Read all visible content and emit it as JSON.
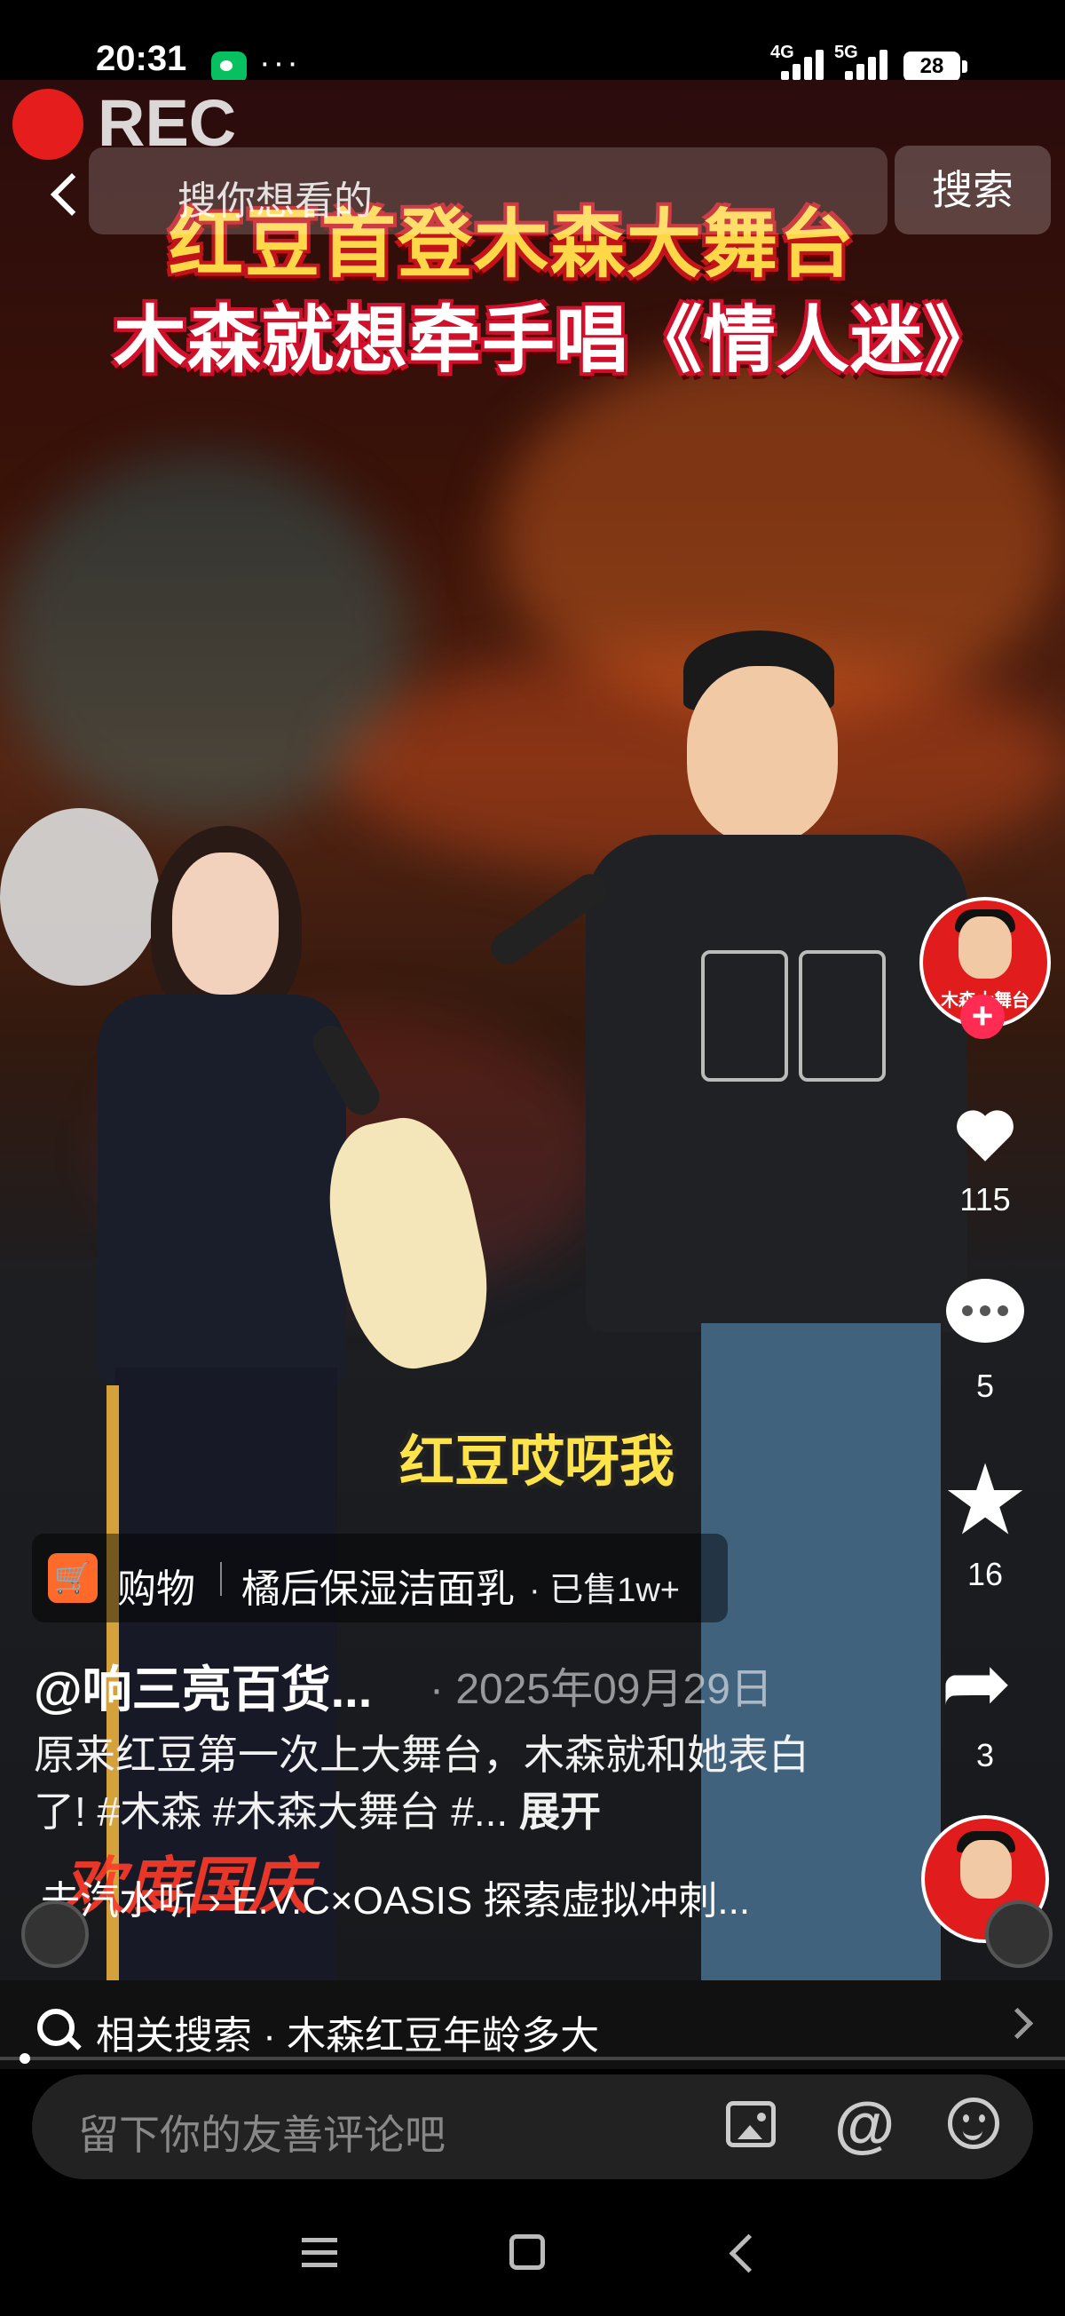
{
  "status_bar": {
    "time": "20:31",
    "net1": "4G",
    "net2": "5G",
    "battery": "28"
  },
  "overlay": {
    "rec_label": "REC",
    "title_line1": "红豆首登木森大舞台",
    "title_line2": "木森就想牵手唱《情人迷》",
    "caption": "红豆哎呀我"
  },
  "search": {
    "placeholder": "搜你想看的",
    "button": "搜索"
  },
  "shop": {
    "label": "购物",
    "item": "橘后保湿洁面乳",
    "sold": "· 已售1w+"
  },
  "post": {
    "author": "@响三亮百货...",
    "date": "· 2025年09月29日",
    "description": "原来红豆第一次上大舞台，木森就和她表白了! #木森 #木森大舞台 #...",
    "expand": "展开",
    "music": "去汽水听 › E.V.C×OASIS 探索虚拟冲刺...",
    "watermark": "欢度国庆"
  },
  "rail": {
    "avatar_text": "木森大舞台",
    "likes": "115",
    "comments": "5",
    "favorites": "16",
    "shares": "3"
  },
  "related": {
    "text": "相关搜索 · 木森红豆年龄多大"
  },
  "comment": {
    "placeholder": "留下你的友善评论吧",
    "at": "@"
  },
  "progress": {
    "fraction": 0.02
  },
  "colors": {
    "accent_red": "#ff2b53",
    "title_yellow": "#ffd84a",
    "shop_orange": "#ff6a2b"
  }
}
